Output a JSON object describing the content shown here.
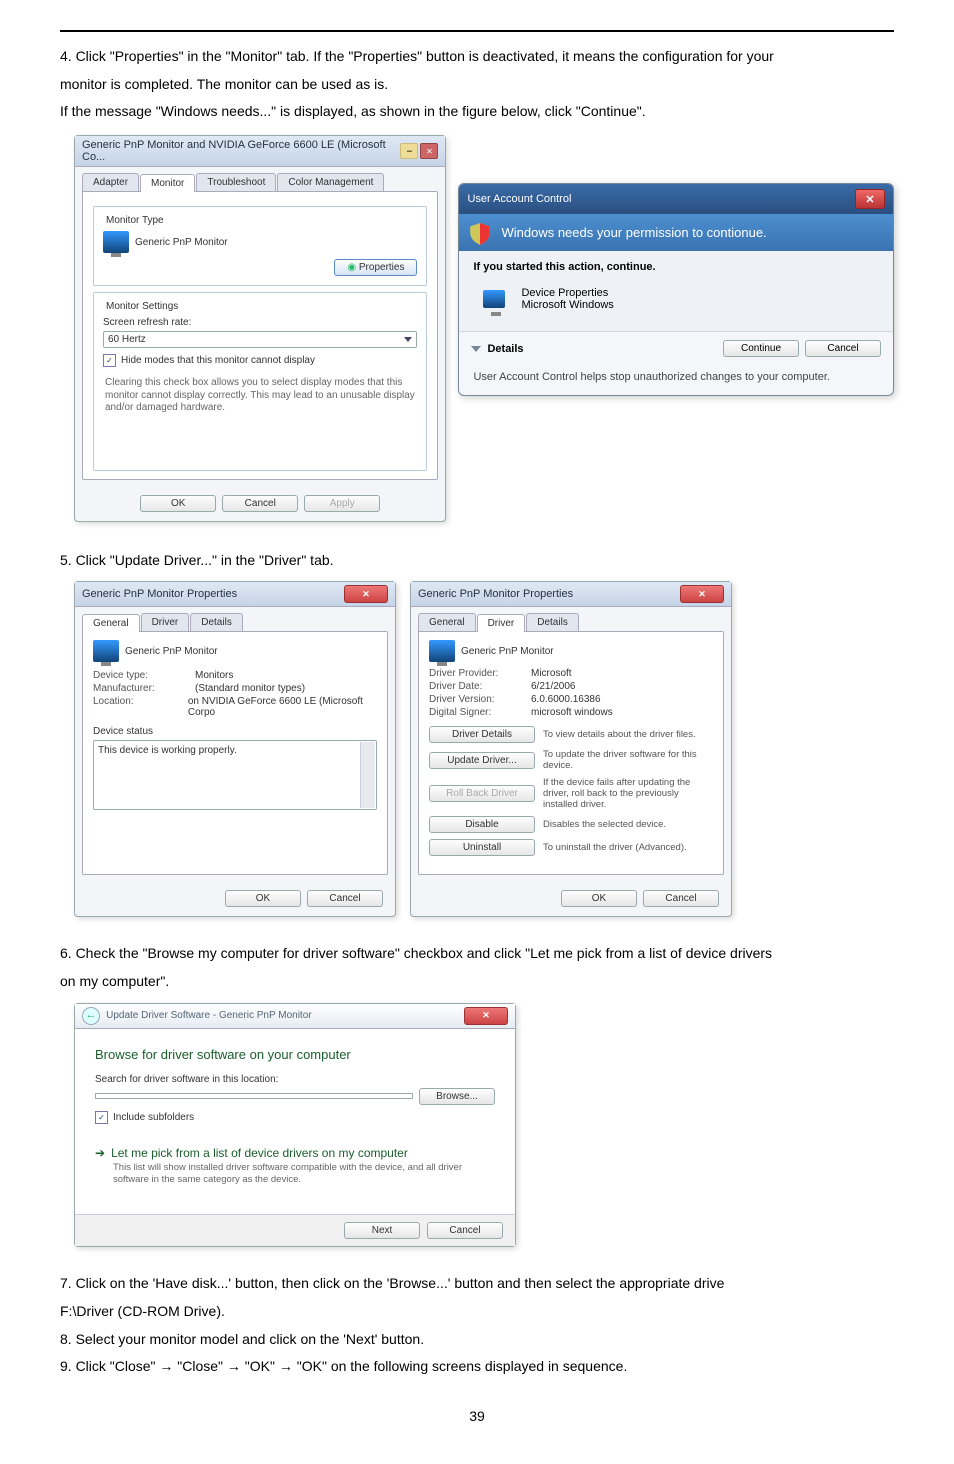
{
  "step4": {
    "line1": "4. Click \"Properties\" in the \"Monitor\" tab. If the \"Properties\" button is deactivated, it means the configuration for your",
    "line2": "monitor is completed. The monitor can be used as is.",
    "line3": "If the message \"Windows needs...\" is displayed, as shown in the figure below, click \"Continue\"."
  },
  "propdialog": {
    "title": "Generic PnP Monitor and NVIDIA GeForce 6600 LE (Microsoft Co...",
    "tabs": [
      "Adapter",
      "Monitor",
      "Troubleshoot",
      "Color Management"
    ],
    "grp_type": "Monitor Type",
    "type_value": "Generic PnP Monitor",
    "btn_props": "Properties",
    "grp_settings": "Monitor Settings",
    "refresh_lbl": "Screen refresh rate:",
    "refresh_val": "60 Hertz",
    "chk": "Hide modes that this monitor cannot display",
    "hint": "Clearing this check box allows you to select display modes that this monitor cannot display correctly. This may lead to an unusable display and/or damaged hardware.",
    "ok": "OK",
    "cancel": "Cancel",
    "apply": "Apply"
  },
  "uac": {
    "bar": "User Account Control",
    "msg": "Windows needs your permission to contionue.",
    "action": "If you started this action, continue.",
    "item1": "Device Properties",
    "item2": "Microsoft Windows",
    "details": "Details",
    "continue": "Continue",
    "cancel": "Cancel",
    "foot": "User Account Control helps stop unauthorized changes to your computer."
  },
  "step5": "5. Click \"Update Driver...\" in the \"Driver\" tab.",
  "dlgA": {
    "title": "Generic PnP Monitor Properties",
    "tabs": [
      "General",
      "Driver",
      "Details"
    ],
    "heading": "Generic PnP Monitor",
    "f1l": "Device type:",
    "f1v": "Monitors",
    "f2l": "Manufacturer:",
    "f2v": "(Standard monitor types)",
    "f3l": "Location:",
    "f3v": "on NVIDIA GeForce 6600 LE (Microsoft Corpo",
    "status_lbl": "Device status",
    "status_txt": "This device is working properly.",
    "ok": "OK",
    "cancel": "Cancel"
  },
  "dlgB": {
    "title": "Generic PnP Monitor Properties",
    "tabs": [
      "General",
      "Driver",
      "Details"
    ],
    "heading": "Generic PnP Monitor",
    "f1l": "Driver Provider:",
    "f1v": "Microsoft",
    "f2l": "Driver Date:",
    "f2v": "6/21/2006",
    "f3l": "Driver Version:",
    "f3v": "6.0.6000.16386",
    "f4l": "Digital Signer:",
    "f4v": "microsoft windows",
    "b1": "Driver Details",
    "d1": "To view details about the driver files.",
    "b2": "Update Driver...",
    "d2": "To update the driver software for this device.",
    "b3": "Roll Back Driver",
    "d3": "If the device fails after updating the driver, roll back to the previously installed driver.",
    "b4": "Disable",
    "d4": "Disables the selected device.",
    "b5": "Uninstall",
    "d5": "To uninstall the driver (Advanced).",
    "ok": "OK",
    "cancel": "Cancel"
  },
  "step6": {
    "l1": "6. Check the \"Browse my computer for driver software\" checkbox and click \"Let me pick from a list of device drivers",
    "l2": "on my computer\"."
  },
  "wiz": {
    "crumb": "Update Driver Software - Generic PnP Monitor",
    "h": "Browse for driver software on your computer",
    "s": "Search for driver software in this location:",
    "path": "",
    "browse": "Browse...",
    "inc": "Include subfolders",
    "ot": "Let me pick from a list of device drivers on my computer",
    "od": "This list will show installed driver software compatible with the device, and all driver software in the same category as the device.",
    "next": "Next",
    "cancel": "Cancel"
  },
  "step7": {
    "l1": "7. Click on the 'Have disk...' button, then click on the 'Browse...' button and then select the appropriate drive",
    "l2": "F:\\Driver (CD-ROM Drive)."
  },
  "step8": "8. Select your monitor model and click on the 'Next' button.",
  "step9": "9. Click \"Close\"  →  \"Close\"  →  \"OK\"  →  \"OK\" on the following screens displayed in sequence.",
  "page": "39"
}
